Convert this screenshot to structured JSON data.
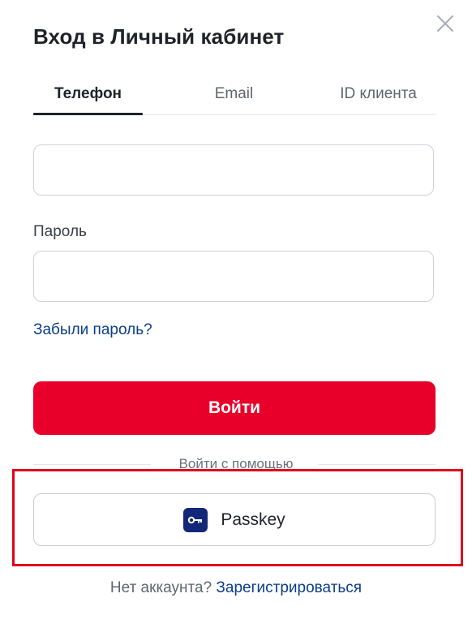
{
  "dialog": {
    "title": "Вход в Личный кабинет",
    "close_icon": "close-icon"
  },
  "tabs": [
    {
      "label": "Телефон",
      "active": true
    },
    {
      "label": "Email",
      "active": false
    },
    {
      "label": "ID клиента",
      "active": false
    }
  ],
  "form": {
    "phone": {
      "value": "",
      "placeholder": ""
    },
    "password_label": "Пароль",
    "password": {
      "value": "",
      "placeholder": ""
    },
    "forgot_password": "Забыли пароль?",
    "submit_label": "Войти"
  },
  "alt_login": {
    "divider_text": "Войти с помощью",
    "passkey_label": "Passkey",
    "passkey_icon": "key-icon"
  },
  "footer": {
    "no_account_text": "Нет аккаунта?",
    "register_link": "Зарегистрироваться"
  },
  "colors": {
    "primary_red": "#e8002a",
    "link_blue": "#0a3c8c",
    "passkey_icon_bg": "#14287a",
    "highlight_red": "#e0001b"
  }
}
